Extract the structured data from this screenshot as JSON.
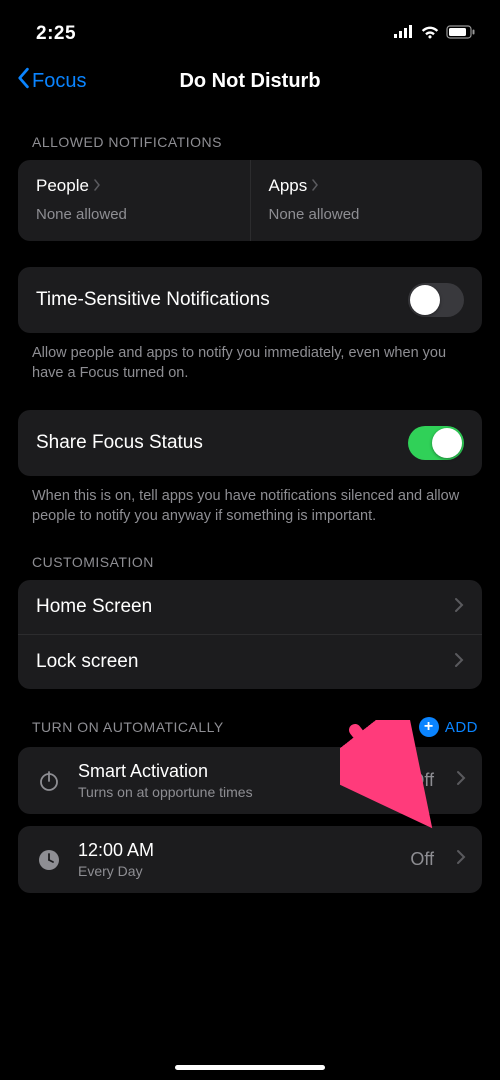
{
  "statusbar": {
    "time": "2:25"
  },
  "nav": {
    "back": "Focus",
    "title": "Do Not Disturb"
  },
  "allowed": {
    "header": "ALLOWED NOTIFICATIONS",
    "people": {
      "title": "People",
      "sub": "None allowed"
    },
    "apps": {
      "title": "Apps",
      "sub": "None allowed"
    }
  },
  "timeSensitive": {
    "title": "Time-Sensitive Notifications",
    "enabled": false,
    "footer": "Allow people and apps to notify you immediately, even when you have a Focus turned on."
  },
  "shareStatus": {
    "title": "Share Focus Status",
    "enabled": true,
    "footer": "When this is on, tell apps you have notifications silenced and allow people to notify you anyway if something is important."
  },
  "customisation": {
    "header": "CUSTOMISATION",
    "homeScreen": "Home Screen",
    "lockScreen": "Lock screen"
  },
  "auto": {
    "header": "TURN ON AUTOMATICALLY",
    "addLabel": "ADD",
    "items": [
      {
        "icon": "power-icon",
        "title": "Smart Activation",
        "sub": "Turns on at opportune times",
        "status": "Off"
      },
      {
        "icon": "clock-icon",
        "title": "12:00 AM",
        "sub": "Every Day",
        "status": "Off"
      }
    ]
  },
  "annotation": {
    "arrowColor": "#ff3b7b"
  }
}
